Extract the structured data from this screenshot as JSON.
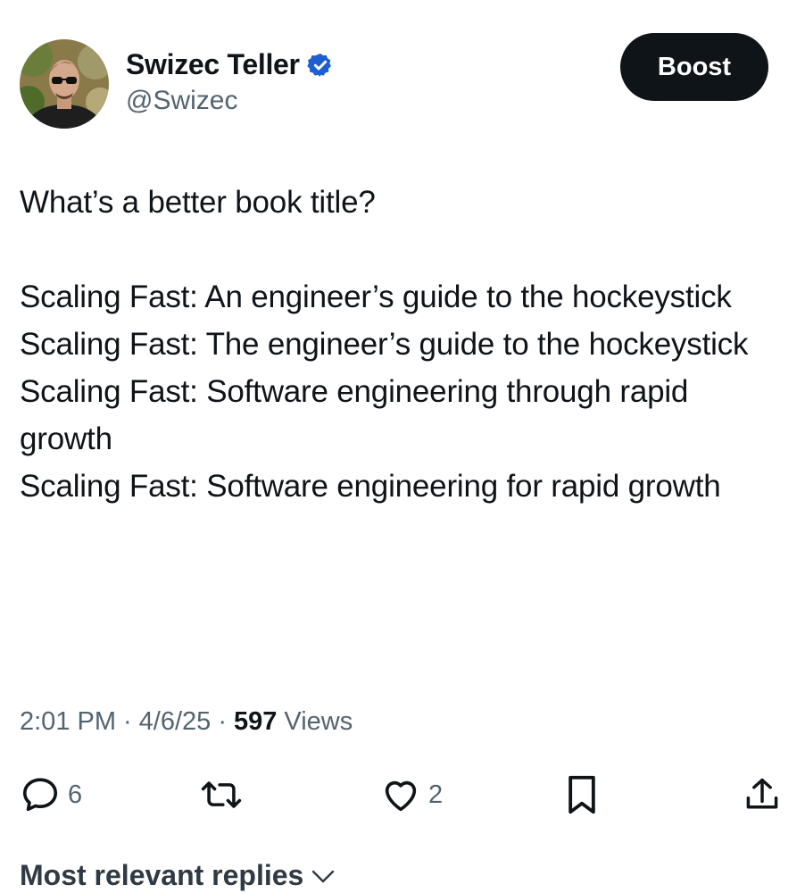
{
  "author": {
    "display_name": "Swizec Teller",
    "handle": "@Swizec",
    "verified": true,
    "verified_badge_color": "#1d5fd3"
  },
  "actions_top": {
    "boost_label": "Boost"
  },
  "tweet": {
    "text": "What’s a better book title?\n\nScaling Fast: An engineer’s guide to the hockeystick\nScaling Fast: The engineer’s guide to the hockeystick\nScaling Fast: Software engineering through rapid growth\nScaling Fast: Software engineering for rapid growth",
    "time": "2:01 PM",
    "date": "4/6/25",
    "separator": "·",
    "views_count": "597",
    "views_label": "Views"
  },
  "engagement": {
    "reply_icon": "reply-icon",
    "reply_count": "6",
    "retweet_icon": "retweet-icon",
    "like_icon": "heart-icon",
    "like_count": "2",
    "bookmark_icon": "bookmark-icon",
    "share_icon": "share-icon"
  },
  "replies": {
    "sort_label": "Most relevant replies"
  },
  "colors": {
    "text": "#0f1419",
    "secondary": "#536471",
    "button_bg": "#0f1419"
  }
}
